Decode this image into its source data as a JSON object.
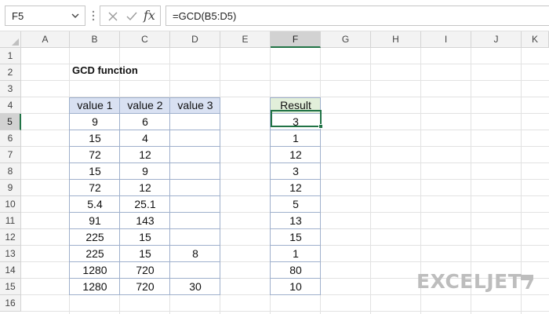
{
  "formula_bar": {
    "name_box": "F5",
    "formula": "=GCD(B5:D5)",
    "fx_label": "fx"
  },
  "columns": [
    "A",
    "B",
    "C",
    "D",
    "E",
    "F",
    "G",
    "H",
    "I",
    "J",
    "K"
  ],
  "rows": [
    "1",
    "2",
    "3",
    "4",
    "5",
    "6",
    "7",
    "8",
    "9",
    "10",
    "11",
    "12",
    "13",
    "14",
    "15",
    "16"
  ],
  "selected_cell": "F5",
  "sheet": {
    "title": "GCD function",
    "table_headers": [
      "value 1",
      "value 2",
      "value 3"
    ],
    "table_rows": [
      [
        "9",
        "6",
        ""
      ],
      [
        "15",
        "4",
        ""
      ],
      [
        "72",
        "12",
        ""
      ],
      [
        "15",
        "9",
        ""
      ],
      [
        "72",
        "12",
        ""
      ],
      [
        "5.4",
        "25.1",
        ""
      ],
      [
        "91",
        "143",
        ""
      ],
      [
        "225",
        "15",
        ""
      ],
      [
        "225",
        "15",
        "8"
      ],
      [
        "1280",
        "720",
        ""
      ],
      [
        "1280",
        "720",
        "30"
      ]
    ],
    "result_header": "Result",
    "results": [
      "3",
      "1",
      "12",
      "3",
      "12",
      "5",
      "13",
      "15",
      "1",
      "80",
      "10"
    ]
  },
  "watermark": {
    "text": "EXCELJET",
    "color": "#bdbdbd"
  },
  "colors": {
    "header_fill": "#d9e1f2",
    "result_header_fill": "#e2efda",
    "selection": "#217346"
  }
}
